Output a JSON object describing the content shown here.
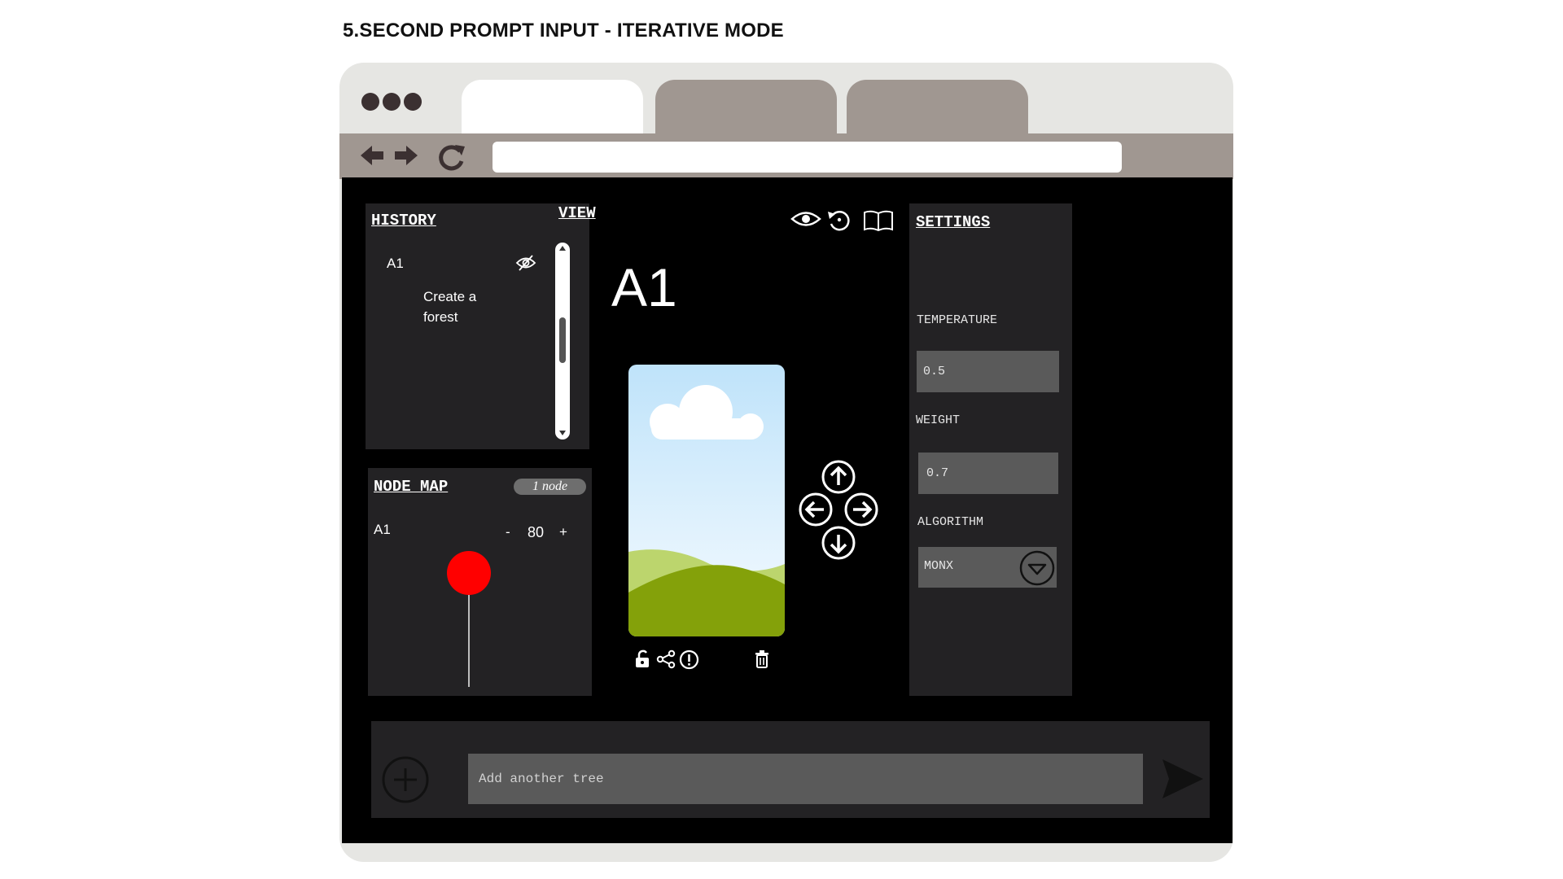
{
  "page_title": "5.SECOND PROMPT INPUT - ITERATIVE MODE",
  "history": {
    "heading": "HISTORY",
    "items": [
      {
        "id": "A1",
        "text_line1": "Create a",
        "text_line2": "forest",
        "icon": "eye-off-icon"
      }
    ]
  },
  "node_map": {
    "heading": "NODE MAP",
    "badge": "1 node",
    "node_label": "A1",
    "zoom_minus": "-",
    "zoom_value": "80",
    "zoom_plus": "+",
    "node_color": "#ff0000"
  },
  "view": {
    "heading": "VIEW",
    "current_id": "A1",
    "toolbar_icons": [
      "eye-icon",
      "history-icon",
      "book-icon"
    ],
    "image_icons": [
      "unlock-icon",
      "share-icon",
      "alert-icon",
      "trash-icon"
    ],
    "nav_icons": [
      "arrow-up-icon",
      "arrow-left-icon",
      "arrow-right-icon",
      "arrow-down-icon"
    ]
  },
  "settings": {
    "heading": "SETTINGS",
    "temperature_label": "TEMPERATURE",
    "temperature_value": "0.5",
    "weight_label": "WEIGHT",
    "weight_value": "0.7",
    "algorithm_label": "ALGORITHM",
    "algorithm_value": "MONX"
  },
  "prompt": {
    "placeholder": "Add another tree",
    "add_icon": "plus-circle-icon",
    "send_icon": "send-icon"
  },
  "colors": {
    "chrome": "#e6e6e3",
    "tab_inactive": "#a09791",
    "panel": "#232224",
    "field": "#5a5a5a",
    "node": "#ff0000"
  }
}
